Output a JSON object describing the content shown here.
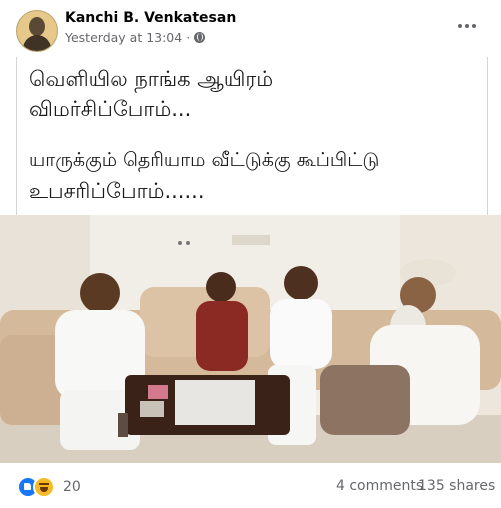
{
  "post": {
    "author": "Kanchi B. Venkatesan",
    "timestamp": "Yesterday at 13:04",
    "privacy_icon": "globe-icon",
    "menu_icon": "more-options-icon"
  },
  "image_text": {
    "line1": "வெளியில நாங்க ஆயிரம்",
    "line2": "விமர்சிப்போம்...",
    "line3": "யாருக்கும் தெரியாம வீட்டுக்கு கூப்பிட்டு",
    "line4": "உபசரிப்போம்......"
  },
  "footer": {
    "reaction_icons": [
      "like-icon",
      "haha-icon"
    ],
    "reaction_count": "20",
    "comments": "4 comments",
    "shares": "135 shares"
  },
  "colors": {
    "link_blue": "#1877f2",
    "meta_gray": "#65676b",
    "haha_yellow": "#f7b928"
  }
}
